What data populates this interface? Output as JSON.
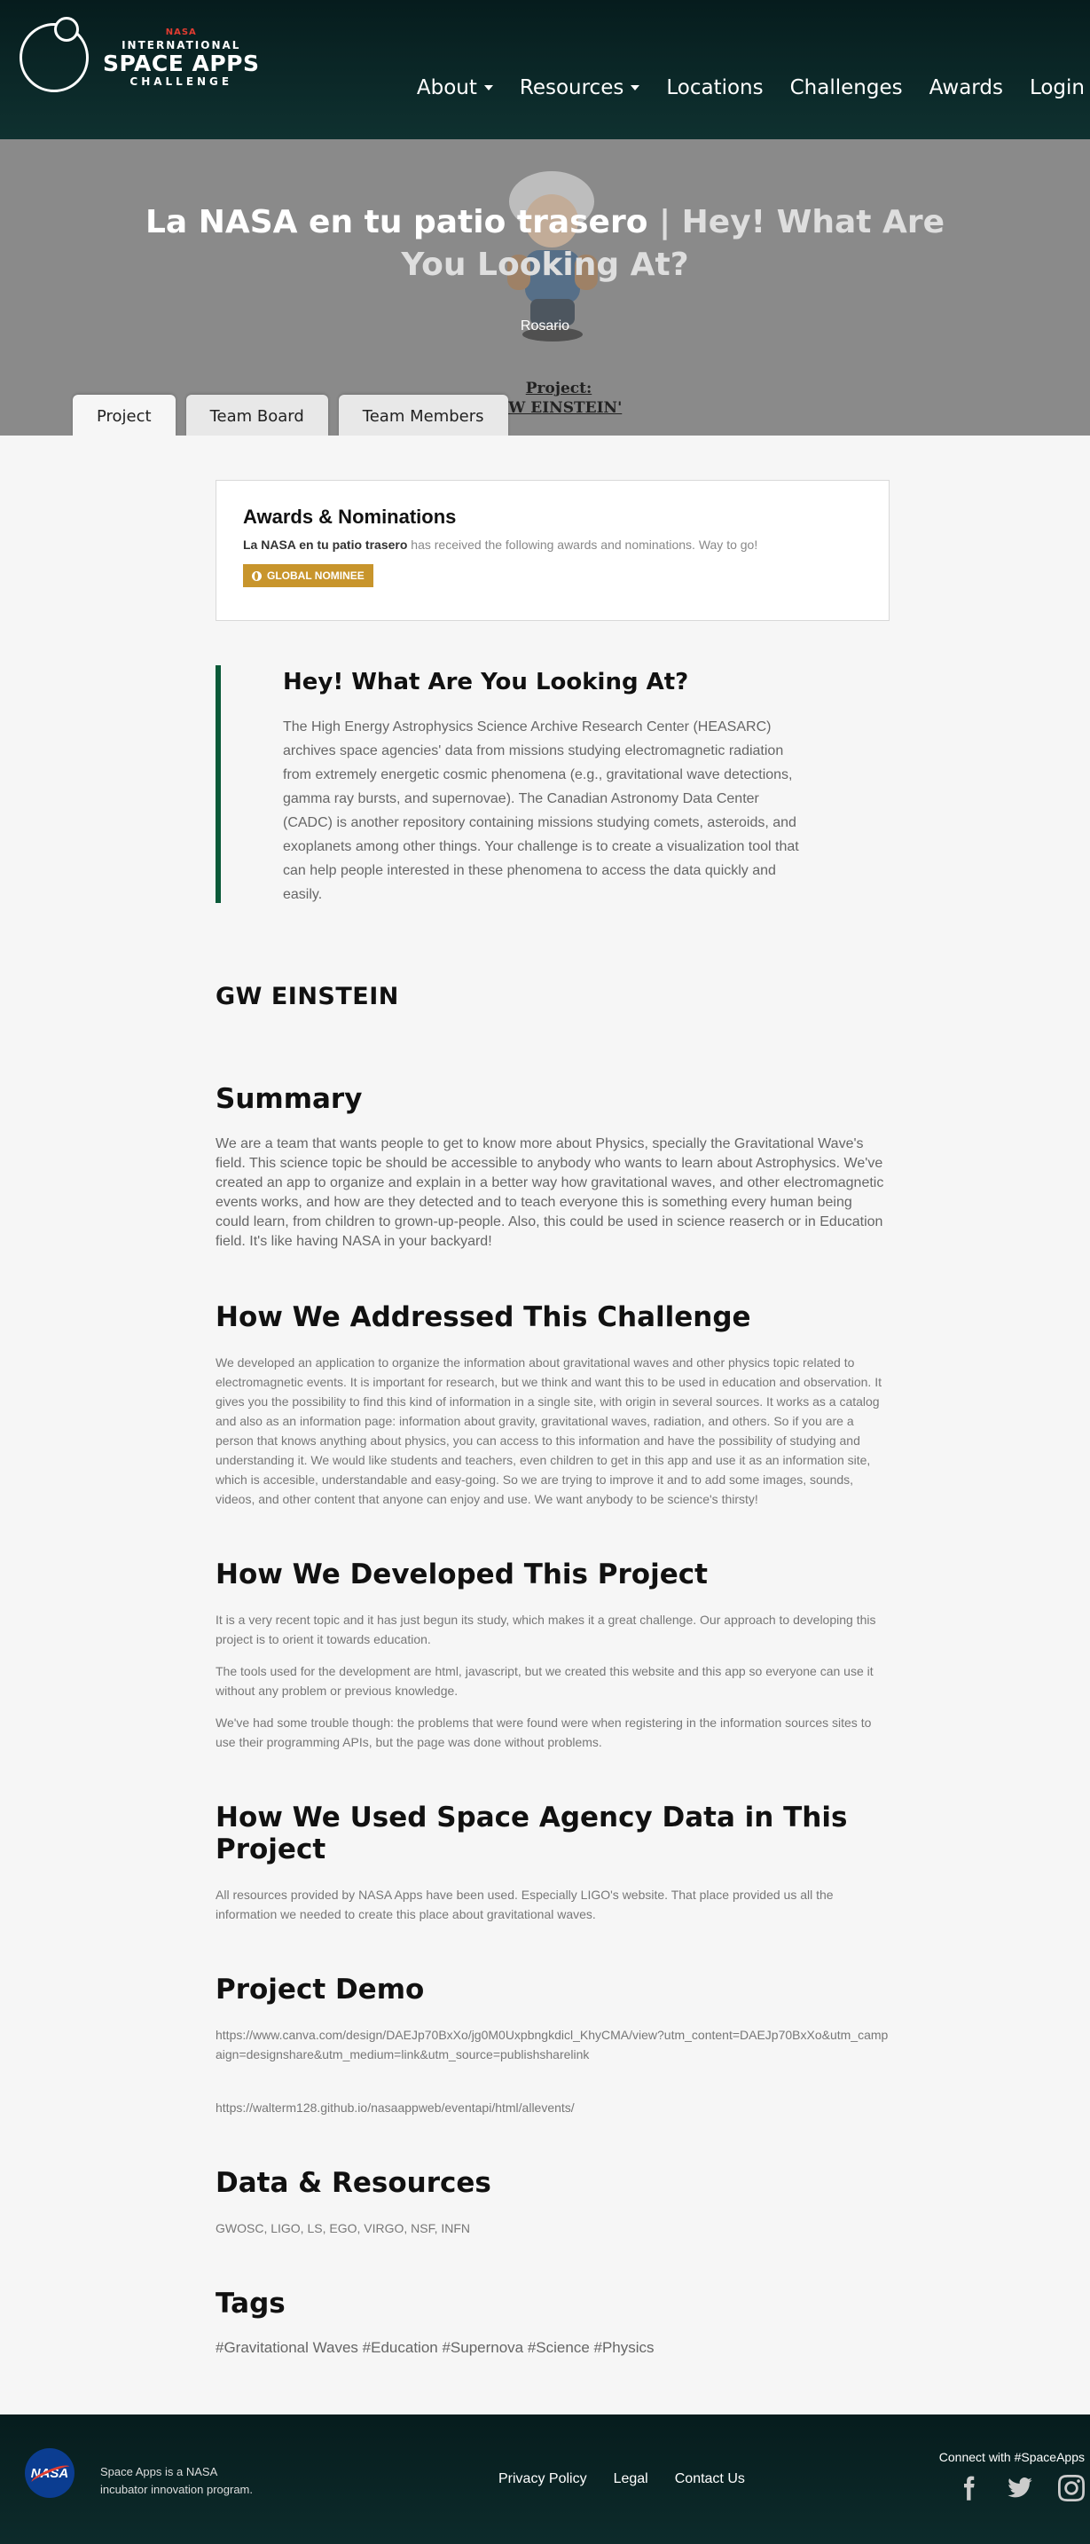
{
  "header": {
    "logo": {
      "nasa": "NASA",
      "line1": "INTERNATIONAL",
      "line2": "SPACE APPS",
      "line3": "CHALLENGE"
    },
    "nav": [
      {
        "label": "About",
        "dropdown": true
      },
      {
        "label": "Resources",
        "dropdown": true
      },
      {
        "label": "Locations",
        "dropdown": false
      },
      {
        "label": "Challenges",
        "dropdown": false
      },
      {
        "label": "Awards",
        "dropdown": false
      },
      {
        "label": "Login",
        "dropdown": false
      }
    ]
  },
  "hero": {
    "project_title": "La NASA en tu patio trasero",
    "separator": " | ",
    "challenge_title": "Hey! What Are You Looking At?",
    "location": "Rosario",
    "overlay_line1": "Project:",
    "overlay_line2": "GW EINSTEIN'"
  },
  "tabs": [
    {
      "label": "Project",
      "active": true
    },
    {
      "label": "Team Board",
      "active": false
    },
    {
      "label": "Team Members",
      "active": false
    }
  ],
  "awards": {
    "title": "Awards & Nominations",
    "project_name": "La NASA en tu patio trasero",
    "desc": " has received the following awards and nominations. Way to go!",
    "badge": "GLOBAL NOMINEE",
    "badge_color": "#c8952c"
  },
  "challenge": {
    "title": "Hey! What Are You Looking At?",
    "text": "The High Energy Astrophysics Science Archive Research Center (HEASARC) archives space agencies' data from missions studying electromagnetic radiation from extremely energetic cosmic phenomena (e.g., gravitational wave detections, gamma ray bursts, and supernovae). The Canadian Astronomy Data Center (CADC) is another repository containing missions studying comets, asteroids, and exoplanets among other things. Your challenge is to create a visualization tool that can help people interested in these phenomena to access the data quickly and easily."
  },
  "team_name": "GW EINSTEIN",
  "sections": {
    "summary": {
      "title": "Summary",
      "text": "We are a team that wants people to get to know more about Physics, specially the Gravitational Wave's field. This science topic be should be accessible to anybody who wants to learn about Astrophysics. We've created an app to organize and explain in a better way how gravitational waves, and other electromagnetic events works, and how are they detected and to teach everyone this is something every human being could learn, from children to grown-up-people. Also, this could be used in science reaserch or in Education field. It's like having NASA in your backyard!"
    },
    "addressed": {
      "title": "How We Addressed This Challenge",
      "text": "We developed an application to organize the information about gravitational waves and other physics topic related to electromagnetic events. It is important for research, but we think and want this to be used in education and observation. It gives you the possibility to find this kind of information in a single site, with origin in several sources. It works as a catalog and also as an information page: information about gravity, gravitational waves, radiation, and others. So if you are a person that knows anything about physics, you can access to this information and have the possibility of studying and understanding it. We would like students and teachers, even children to get in this app and use it as an information site, which is accesible, understandable and easy-going. So we are trying to improve it and to add some images, sounds, videos, and other content that anyone can enjoy and use. We want anybody to be science's thirsty!"
    },
    "developed": {
      "title": "How We Developed This Project",
      "paragraphs": [
        "It is a very recent topic and it has just begun its study, which makes it a great challenge. Our approach to developing this project is to orient it towards education.",
        "The tools used for the development are html, javascript, but we created this website and this app so everyone can use it without any problem or previous knowledge.",
        "We've had some trouble though: the problems that were found were when registering in the information sources sites to use their programming APIs, but the page was done without problems."
      ]
    },
    "data_used": {
      "title": "How We Used Space Agency Data in This Project",
      "text": "All resources provided by NASA Apps have been used. Especially LIGO's website. That place provided us all the information we needed to create this place about gravitational waves."
    },
    "demo": {
      "title": "Project Demo",
      "links": [
        "https://www.canva.com/design/DAEJp70BxXo/jg0M0Uxpbngkdicl_KhyCMA/view?utm_content=DAEJp70BxXo&utm_campaign=designshare&utm_medium=link&utm_source=publishsharelink",
        "https://walterm128.github.io/nasaappweb/eventapi/html/allevents/"
      ]
    },
    "resources": {
      "title": "Data & Resources",
      "text": "GWOSC, LIGO, LS, EGO, VIRGO, NSF, INFN"
    },
    "tags": {
      "title": "Tags",
      "text": "#Gravitational Waves #Education #Supernova #Science #Physics"
    }
  },
  "footer": {
    "nasa_logo": "NASA",
    "tagline_line1": "Space Apps is a NASA",
    "tagline_line2": "incubator innovation program.",
    "links": [
      "Privacy Policy",
      "Legal",
      "Contact Us"
    ],
    "connect": "Connect with #SpaceApps",
    "social": [
      "facebook-icon",
      "twitter-icon",
      "instagram-icon"
    ]
  }
}
